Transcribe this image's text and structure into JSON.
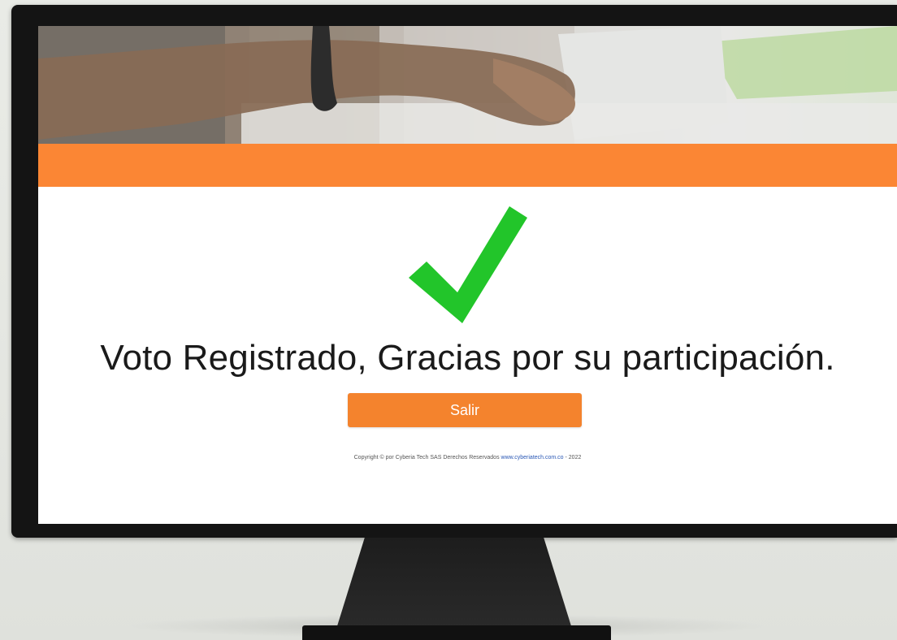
{
  "confirmation": {
    "message": "Voto Registrado, Gracias por su participación.",
    "exit_label": "Salir"
  },
  "footer": {
    "copyright_text": "Copyright © por Cyberia Tech SAS Derechos Reservados",
    "link_text": "www.cyberiatech.com.co",
    "year_text": "- 2022"
  },
  "icons": {
    "status": "check-mark-icon"
  },
  "colors": {
    "accent_orange": "#fb8634",
    "button_orange": "#f4832d",
    "check_green": "#22c52a",
    "link_blue": "#2a58b5"
  }
}
